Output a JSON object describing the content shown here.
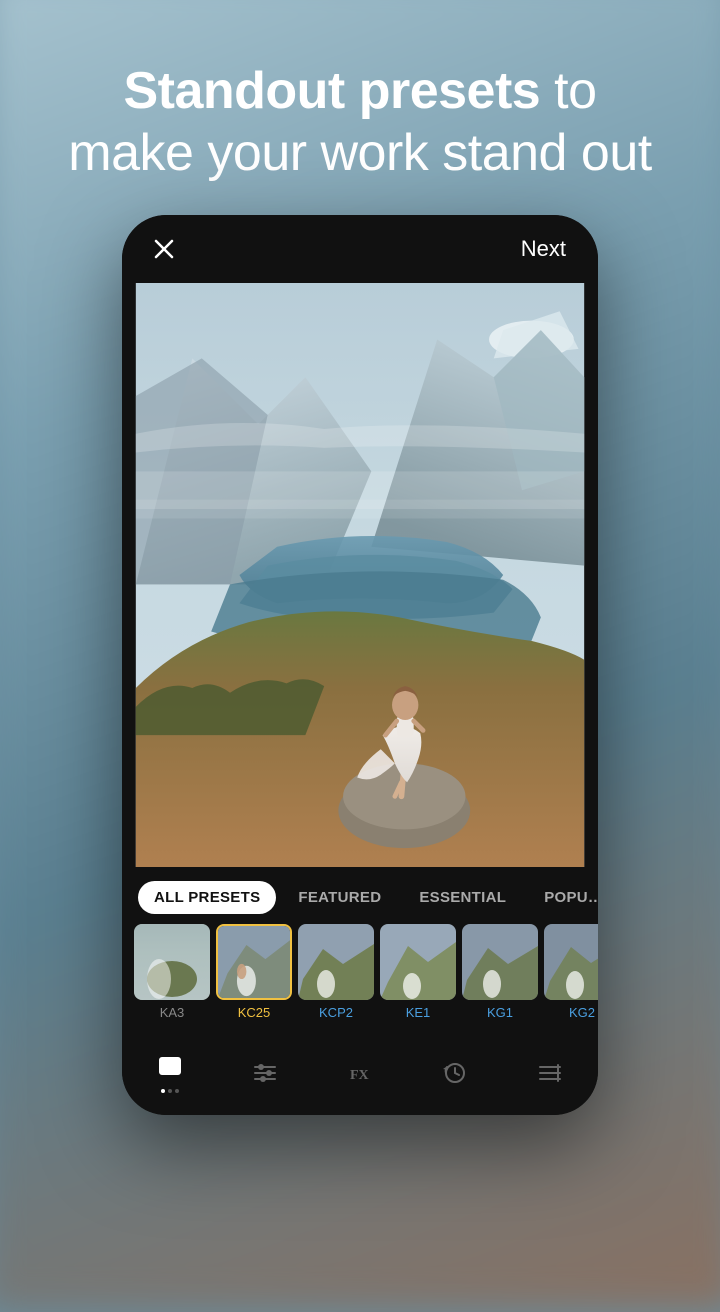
{
  "background": {
    "colors": [
      "#a8c4d0",
      "#7a9fb0",
      "#5a7f90",
      "#8a7060"
    ]
  },
  "headline": {
    "bold_text": "Standout presets",
    "regular_text": " to\nmake your work stand out"
  },
  "phone": {
    "close_label": "×",
    "next_label": "Next"
  },
  "tabs": [
    {
      "label": "ALL PRESETS",
      "active": true
    },
    {
      "label": "FEATURED",
      "active": false
    },
    {
      "label": "ESSENTIAL",
      "active": false
    },
    {
      "label": "POPU…",
      "active": false
    }
  ],
  "presets": [
    {
      "id": "KA3",
      "label": "KA3",
      "active": false,
      "label_color": "default"
    },
    {
      "id": "KC25",
      "label": "KC25",
      "active": true,
      "label_color": "yellow"
    },
    {
      "id": "KCP2",
      "label": "KCP2",
      "active": false,
      "label_color": "blue"
    },
    {
      "id": "KE1",
      "label": "KE1",
      "active": false,
      "label_color": "blue"
    },
    {
      "id": "KG1",
      "label": "KG1",
      "active": false,
      "label_color": "blue"
    },
    {
      "id": "KG2",
      "label": "KG2",
      "active": false,
      "label_color": "blue"
    }
  ],
  "toolbar": {
    "items": [
      {
        "id": "presets",
        "label": "presets",
        "active": true
      },
      {
        "id": "adjustments",
        "label": "adjustments",
        "active": false
      },
      {
        "id": "fx",
        "label": "fx",
        "active": false
      },
      {
        "id": "history",
        "label": "history",
        "active": false
      },
      {
        "id": "menu",
        "label": "menu",
        "active": false
      }
    ]
  }
}
